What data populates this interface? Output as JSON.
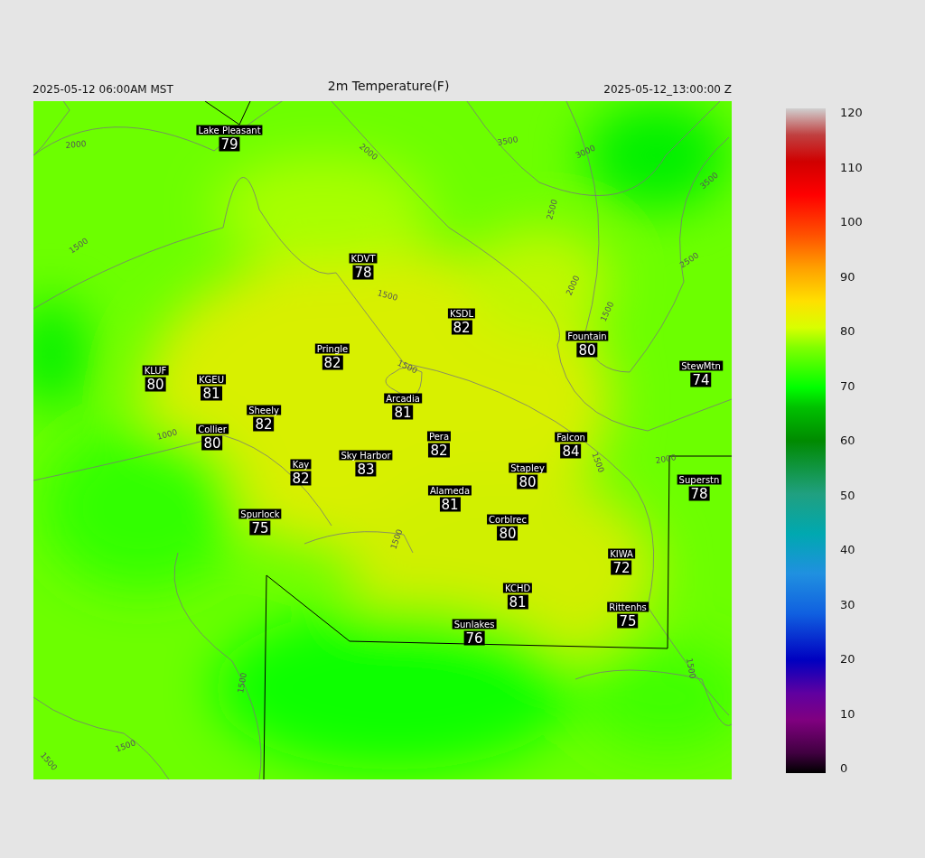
{
  "header": {
    "local_time": "2025-05-12 06:00AM MST",
    "title": "2m Temperature(F)",
    "valid_time": "2025-05-12_13:00:00 Z"
  },
  "map": {
    "stations": [
      {
        "name": "Lake Pleasant",
        "value": "79"
      },
      {
        "name": "KDVT",
        "value": "78"
      },
      {
        "name": "KSDL",
        "value": "82"
      },
      {
        "name": "Fountain",
        "value": "80"
      },
      {
        "name": "Pringle",
        "value": "82"
      },
      {
        "name": "KLUF",
        "value": "80"
      },
      {
        "name": "KGEU",
        "value": "81"
      },
      {
        "name": "StewMtn",
        "value": "74"
      },
      {
        "name": "Arcadia",
        "value": "81"
      },
      {
        "name": "Sheely",
        "value": "82"
      },
      {
        "name": "Collier",
        "value": "80"
      },
      {
        "name": "Pera",
        "value": "82"
      },
      {
        "name": "Falcon",
        "value": "84"
      },
      {
        "name": "Sky Harbor",
        "value": "83"
      },
      {
        "name": "Kay",
        "value": "82"
      },
      {
        "name": "Stapley",
        "value": "80"
      },
      {
        "name": "Superstn",
        "value": "78"
      },
      {
        "name": "Alameda",
        "value": "81"
      },
      {
        "name": "Spurlock",
        "value": "75"
      },
      {
        "name": "Corblrec",
        "value": "80"
      },
      {
        "name": "KIWA",
        "value": "72"
      },
      {
        "name": "KCHD",
        "value": "81"
      },
      {
        "name": "Rittenhs",
        "value": "75"
      },
      {
        "name": "Sunlakes",
        "value": "76"
      }
    ],
    "contour_labels": [
      "2000",
      "2000",
      "3500",
      "3000",
      "3500",
      "2500",
      "2500",
      "2000",
      "1500",
      "1500",
      "1500",
      "1500",
      "1000",
      "1500",
      "2000",
      "1500",
      "1500",
      "1500",
      "1500",
      "1500"
    ]
  },
  "colorbar": {
    "ticks": [
      "120",
      "110",
      "100",
      "90",
      "80",
      "70",
      "60",
      "50",
      "40",
      "30",
      "20",
      "10",
      "0"
    ]
  }
}
